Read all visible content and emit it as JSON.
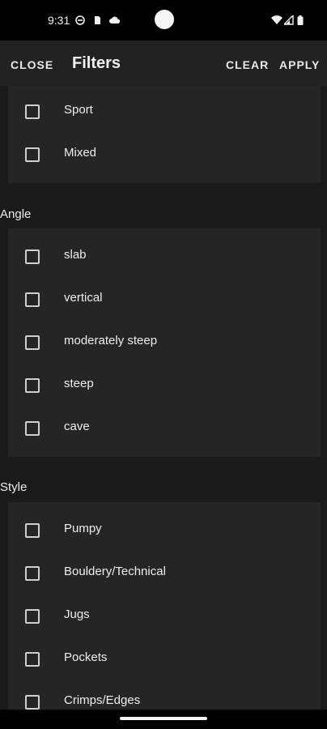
{
  "status_bar": {
    "time": "9:31",
    "left_icons": [
      "dnd-icon",
      "sim-icon",
      "cloud-icon"
    ],
    "right_icons": [
      "wifi-icon",
      "signal-icon",
      "battery-icon"
    ]
  },
  "app_bar": {
    "close_label": "CLOSE",
    "title": "Filters",
    "clear_label": "CLEAR",
    "apply_label": "APPLY"
  },
  "sections": {
    "type": {
      "items": [
        {
          "label": "Sport",
          "checked": false
        },
        {
          "label": "Mixed",
          "checked": false
        }
      ]
    },
    "angle": {
      "title": "Angle",
      "items": [
        {
          "label": "slab",
          "checked": false
        },
        {
          "label": "vertical",
          "checked": false
        },
        {
          "label": "moderately steep",
          "checked": false
        },
        {
          "label": "steep",
          "checked": false
        },
        {
          "label": "cave",
          "checked": false
        }
      ]
    },
    "style": {
      "title": "Style",
      "items": [
        {
          "label": "Pumpy",
          "checked": false
        },
        {
          "label": "Bouldery/Technical",
          "checked": false
        },
        {
          "label": "Jugs",
          "checked": false
        },
        {
          "label": "Pockets",
          "checked": false
        },
        {
          "label": "Crimps/Edges",
          "checked": false
        }
      ]
    }
  },
  "colors": {
    "background": "#1a1a1a",
    "card": "#252525",
    "app_bar": "#222222",
    "text": "#eeeeee"
  }
}
